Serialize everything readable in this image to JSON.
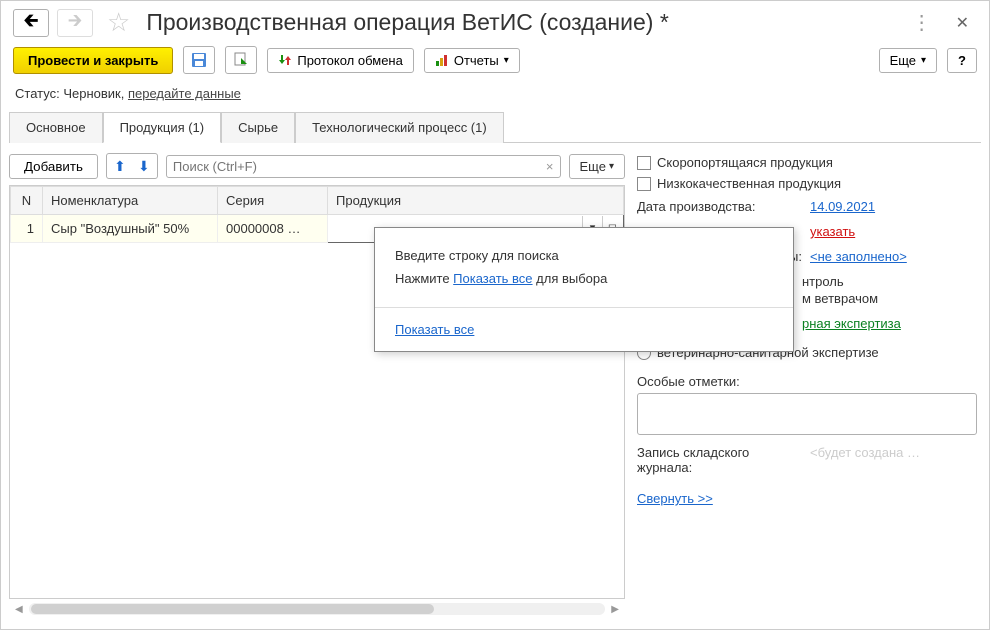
{
  "header": {
    "title": "Производственная операция ВетИС (создание) *"
  },
  "toolbar": {
    "post_close": "Провести и закрыть",
    "protocol": "Протокол обмена",
    "reports": "Отчеты",
    "more": "Еще",
    "help": "?"
  },
  "status": {
    "label": "Статус:",
    "value": "Черновик,",
    "link": "передайте данные"
  },
  "tabs": [
    {
      "label": "Основное"
    },
    {
      "label": "Продукция (1)"
    },
    {
      "label": "Сырье"
    },
    {
      "label": "Технологический процесс (1)"
    }
  ],
  "table_toolbar": {
    "add": "Добавить",
    "search_placeholder": "Поиск (Ctrl+F)",
    "more": "Еще"
  },
  "table": {
    "headers": {
      "n": "N",
      "nom": "Номенклатура",
      "series": "Серия",
      "product": "Продукция"
    },
    "rows": [
      {
        "n": "1",
        "nom": "Сыр \"Воздушный\" 50%",
        "series": "00000008 …",
        "product": ""
      }
    ]
  },
  "dropdown": {
    "line1": "Введите строку для поиска",
    "line2a": "Нажмите ",
    "line2b": "Показать все",
    "line2c": " для выбора",
    "show_all": "Показать все"
  },
  "right": {
    "cb_perishable": "Скоропортящаяся продукция",
    "cb_lowquality": "Низкокачественная продукция",
    "date_label": "Дата производства:",
    "date_value": "14.09.2021",
    "specify": "указать",
    "notfilled_suffix": "ы:",
    "notfilled": "<не заполнено>",
    "ctrl_frag1": "нтроль",
    "ctrl_frag2": "м ветврачом",
    "expertise": "рная экспертиза",
    "radio_label": "ветеринарно-санитарной экспертизе",
    "marks_label": "Особые отметки:",
    "journal_label": "Запись складского журнала:",
    "journal_hint": "<будет создана …",
    "collapse": "Свернуть >>"
  }
}
